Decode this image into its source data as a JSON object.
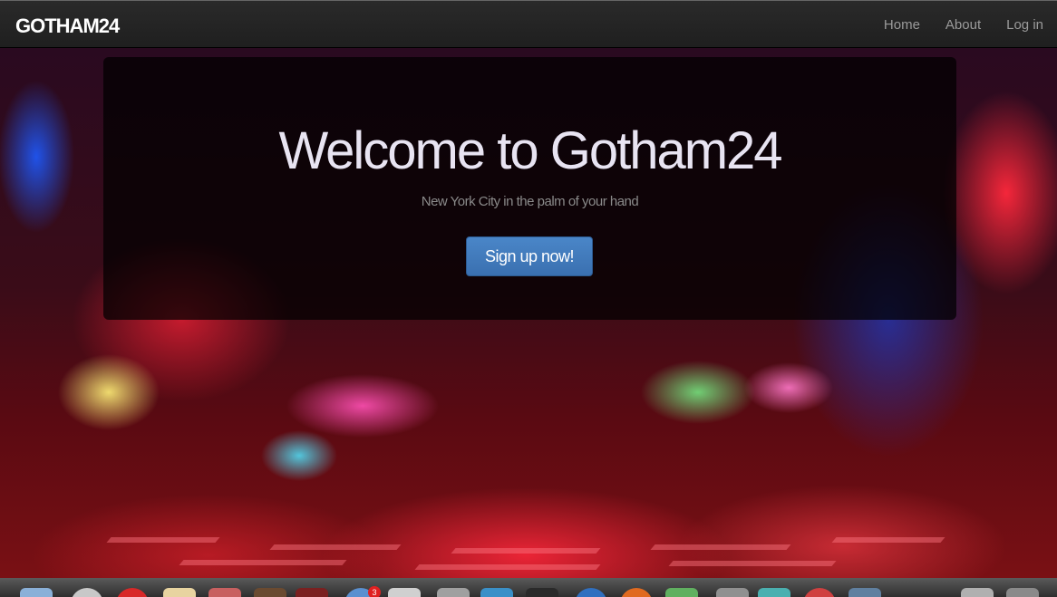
{
  "navbar": {
    "brand": "GOTHAM24",
    "links": [
      "Home",
      "About",
      "Log in"
    ]
  },
  "hero": {
    "title": "Welcome to Gotham24",
    "subtitle": "New York City in the palm of your hand",
    "cta_label": "Sign up now!"
  },
  "dock": {
    "badge": "3"
  },
  "colors": {
    "navbar": "#222222",
    "cta": "#3f7ac0",
    "title": "#e8e4f2"
  }
}
